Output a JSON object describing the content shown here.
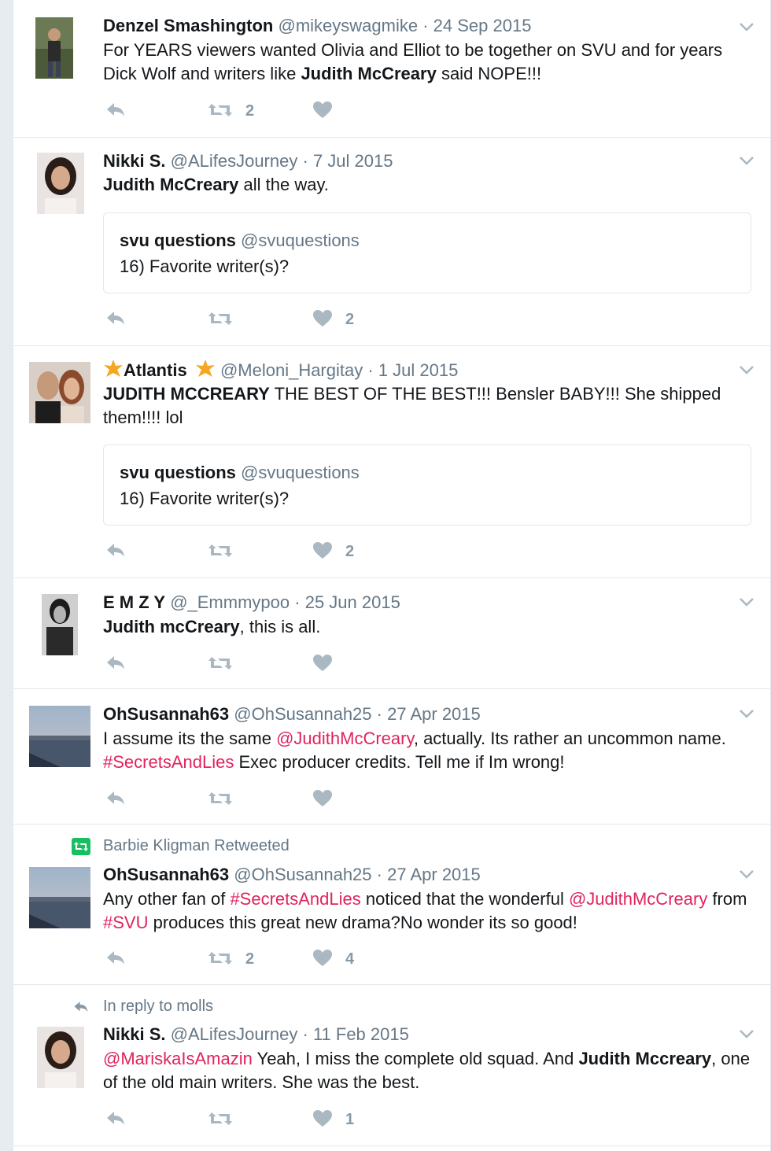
{
  "tweets": [
    {
      "name": "Denzel Smashington",
      "handle": "@mikeyswagmike",
      "separator": "·",
      "date": "24 Sep 2015",
      "text_parts": [
        "For YEARS viewers wanted Olivia and Elliot to be together on SVU and for years Dick Wolf and writers like ",
        "Judith McCreary",
        " said NOPE!!!"
      ],
      "retweets": "2",
      "likes": ""
    },
    {
      "name": "Nikki S.",
      "handle": "@ALifesJourney",
      "separator": "·",
      "date": "7 Jul 2015",
      "text_parts": [
        "Judith McCreary",
        " all the way."
      ],
      "quote": {
        "name": "svu questions",
        "handle": "@svuquestions",
        "text": "16) Favorite writer(s)?"
      },
      "retweets": "",
      "likes": "2"
    },
    {
      "name": "Atlantis",
      "handle": "@Meloni_Hargitay",
      "separator": "·",
      "date": "1 Jul 2015",
      "text_parts": [
        "JUDITH MCCREARY",
        " THE BEST OF THE BEST!!! Bensler BABY!!! She shipped them!!!! lol"
      ],
      "quote": {
        "name": "svu questions",
        "handle": "@svuquestions",
        "text": "16) Favorite writer(s)?"
      },
      "retweets": "",
      "likes": "2"
    },
    {
      "name": "E M Z Y",
      "handle": "@_Emmmypoo",
      "separator": "·",
      "date": "25 Jun 2015",
      "text_parts": [
        "Judith mcCreary",
        ", this is all."
      ],
      "retweets": "",
      "likes": ""
    },
    {
      "name": "OhSusannah63",
      "handle": "@OhSusannah25",
      "separator": "·",
      "date": "27 Apr 2015",
      "text_parts": [
        "I assume its the same ",
        "@JudithMcCreary",
        ", actually. Its rather an uncommon name. ",
        "#SecretsAndLies",
        " Exec producer credits. Tell me if Im wrong!"
      ],
      "retweets": "",
      "likes": ""
    },
    {
      "context": "Barbie Kligman Retweeted",
      "name": "OhSusannah63",
      "handle": "@OhSusannah25",
      "separator": "·",
      "date": "27 Apr 2015",
      "text_parts": [
        "Any other fan of ",
        "#SecretsAndLies",
        " noticed that the wonderful ",
        "@JudithMcCreary",
        " from ",
        "#SVU",
        " produces this great new drama?No wonder its so good!"
      ],
      "retweets": "2",
      "likes": "4"
    },
    {
      "context": "In reply to molls",
      "name": "Nikki S.",
      "handle": "@ALifesJourney",
      "separator": "·",
      "date": "11 Feb 2015",
      "text_parts": [
        "@MariskaIsAmazin",
        " Yeah,  I miss the complete old squad. And ",
        "Judith Mccreary",
        ", one of the old main writers. She was the best."
      ],
      "retweets": "",
      "likes": "1"
    }
  ],
  "colors": {
    "accent_red": "#e0245e",
    "retweet_green": "#17bf63",
    "icon_gray": "#aab8c2",
    "meta_gray": "#657786",
    "border": "#e1e8ed",
    "star": "#f5a623"
  },
  "icons": [
    "reply-icon",
    "retweet-icon",
    "heart-icon",
    "chevron-down-icon",
    "star-icon",
    "retweet-context-icon",
    "reply-context-icon"
  ]
}
